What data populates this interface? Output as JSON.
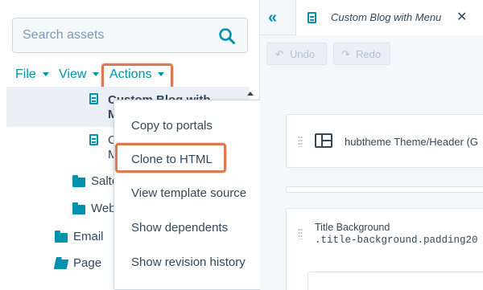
{
  "sidebar": {
    "search": {
      "placeholder": "Search assets",
      "icon": "search-icon"
    },
    "menu": {
      "file_label": "File",
      "view_label": "View",
      "actions_label": "Actions"
    },
    "tree": {
      "selected_item_line1": "Custom Blog with",
      "selected_item_line2": "Menu",
      "item2_line1": "C",
      "item2_line2": "M",
      "folder_salted": "Salte",
      "folder_web": "Web",
      "folder_email": "Email",
      "folder_page": "Page"
    }
  },
  "actions_menu": {
    "items": [
      "Copy to portals",
      "Clone to HTML",
      "View template source",
      "Show dependents",
      "Show revision history"
    ]
  },
  "editor": {
    "tab_title": "Custom Blog with Menu",
    "undo_label": "Undo",
    "redo_label": "Redo",
    "module1_label": "hubtheme Theme/Header (G",
    "module2_title": "Title Background",
    "module2_selector": ".title-background.padding20"
  },
  "colors": {
    "link": "#0091ae",
    "highlight": "#d97a52",
    "text": "#33475b"
  }
}
